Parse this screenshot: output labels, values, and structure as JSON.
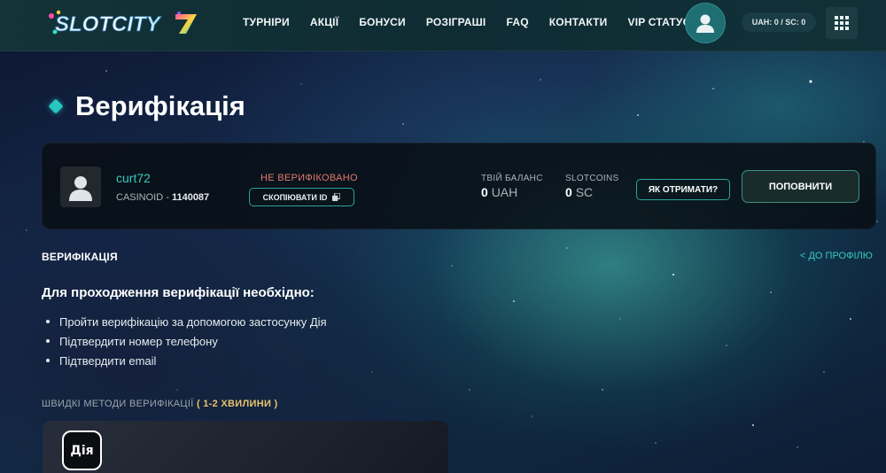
{
  "header": {
    "logo_text": "SLOTCITY",
    "nav": [
      "ТУРНІРИ",
      "АКЦІЇ",
      "БОНУСИ",
      "РОЗІГРАШІ",
      "FAQ",
      "КОНТАКТИ",
      "VIP СТАТУС"
    ],
    "balance_pill": "UAH: 0 / SC: 0",
    "icons": {
      "avatar": "user-avatar-icon",
      "menu": "grid-menu-icon"
    }
  },
  "page": {
    "title": "Верифікація"
  },
  "profile": {
    "username": "curt72",
    "casinoid_label": "CASINOID - ",
    "casinoid_value": "1140087",
    "status": "НЕ ВЕРИФІКОВАНО",
    "copy_id_label": "СКОПІЮВАТИ ID",
    "balance_label": "ТВІЙ БАЛАНС",
    "balance_amount": "0",
    "balance_currency": "UAH",
    "slotcoins_label": "SLOTCOINS",
    "slotcoins_amount": "0",
    "slotcoins_currency": "SC",
    "how_to_get_label": "ЯК ОТРИМАТИ?",
    "top_up_label": "ПОПОВНИТИ"
  },
  "verification": {
    "section_title": "ВЕРИФІКАЦІЯ",
    "back_link": "< ДО ПРОФІЛЮ",
    "requirements_title": "Для проходження верифікації необхідно:",
    "requirements": [
      "Пройти верифікацію за допомогою застосунку Дія",
      "Підтвердити номер телефону",
      "Підтвердити email"
    ],
    "quick_methods_label": "ШВИДКІ МЕТОДИ ВЕРИФІКАЦІЇ",
    "quick_methods_time": "( 1-2 ХВИЛИНИ )",
    "diia_label": "Дія"
  },
  "colors": {
    "accent": "#37c9bd",
    "status_warning": "#e0796d",
    "highlight": "#e8c36a"
  }
}
